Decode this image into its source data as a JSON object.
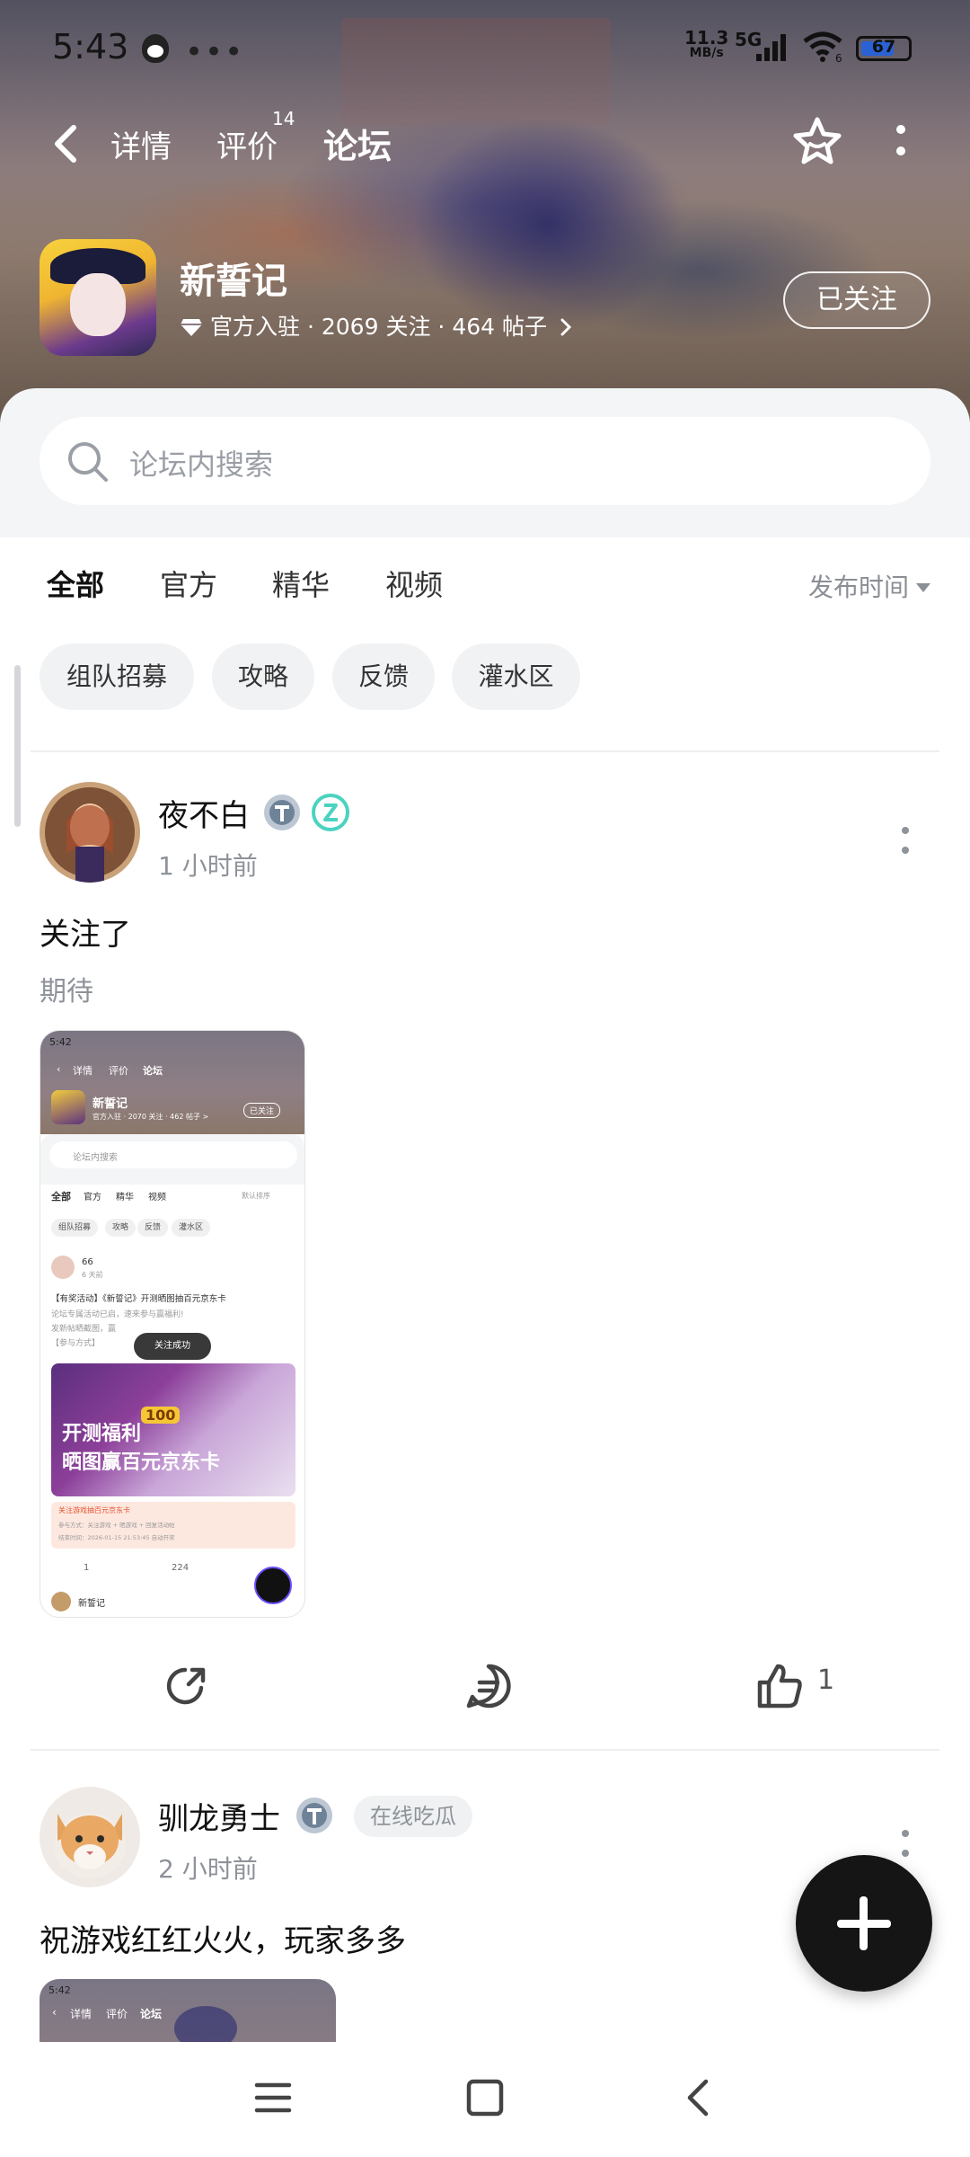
{
  "status_bar": {
    "time": "5:43",
    "speed_value": "11.3",
    "speed_unit": "MB/s",
    "network": "5G",
    "wifi_level": "6",
    "battery": "67"
  },
  "nav": {
    "tabs": [
      "详情",
      "评价",
      "论坛"
    ],
    "review_count": "14",
    "active_tab": "论坛"
  },
  "game": {
    "name": "新誓记",
    "official": "官方入驻",
    "followers": "2069 关注",
    "posts": "464 帖子",
    "follow_button": "已关注"
  },
  "search": {
    "placeholder": "论坛内搜索"
  },
  "filter_tabs": [
    "全部",
    "官方",
    "精华",
    "视频"
  ],
  "sort_label": "发布时间",
  "chips": [
    "组队招募",
    "攻略",
    "反馈",
    "灌水区"
  ],
  "posts": [
    {
      "author": "夜不白",
      "time": "1 小时前",
      "title": "关注了",
      "body": "期待",
      "screenshot": {
        "time": "5:42",
        "tabs": [
          "详情",
          "评价",
          "论坛"
        ],
        "game_name": "新誓记",
        "meta": "官方入驻 · 2070 关注 · 462 帖子 >",
        "follow": "已关注",
        "search": "论坛内搜索",
        "filter_tabs": [
          "全部",
          "官方",
          "精华",
          "视频"
        ],
        "sort": "默认排序",
        "chips": [
          "组队招募",
          "攻略",
          "反馈",
          "灌水区"
        ],
        "post_author": "66",
        "post_time": "6 天前",
        "post_title": "【有奖活动】《新誓记》开测晒图抽百元京东卡",
        "post_line1": "论坛专属活动已启，速来参与赢福利!",
        "post_line2": "发新帖晒截图，赢",
        "post_line3": "【参与方式】",
        "toast": "关注成功",
        "banner_line1": "开测福利",
        "banner_line2": "晒图赢百元京东卡",
        "banner_coin": "100",
        "bar_title": "关注游戏抽百元京东卡",
        "bar_line1": "参与方式：关注游戏 + 晒游戏 + 回复活动帖",
        "bar_line2": "结束时间：2026-01-15 21:53:45 自动开奖",
        "share_count": "1",
        "comment_count": "224",
        "next_author": "新誓记"
      },
      "like_count": "1"
    },
    {
      "author": "驯龙勇士",
      "tag": "在线吃瓜",
      "time": "2 小时前",
      "title": "祝游戏红红火火，玩家多多",
      "screenshot": {
        "time": "5:42",
        "tabs": [
          "详情",
          "评价",
          "论坛"
        ]
      }
    }
  ],
  "colors": {
    "accent": "#2fd1b6",
    "fab": "#151515",
    "fab_ring": "#6d4bff"
  }
}
